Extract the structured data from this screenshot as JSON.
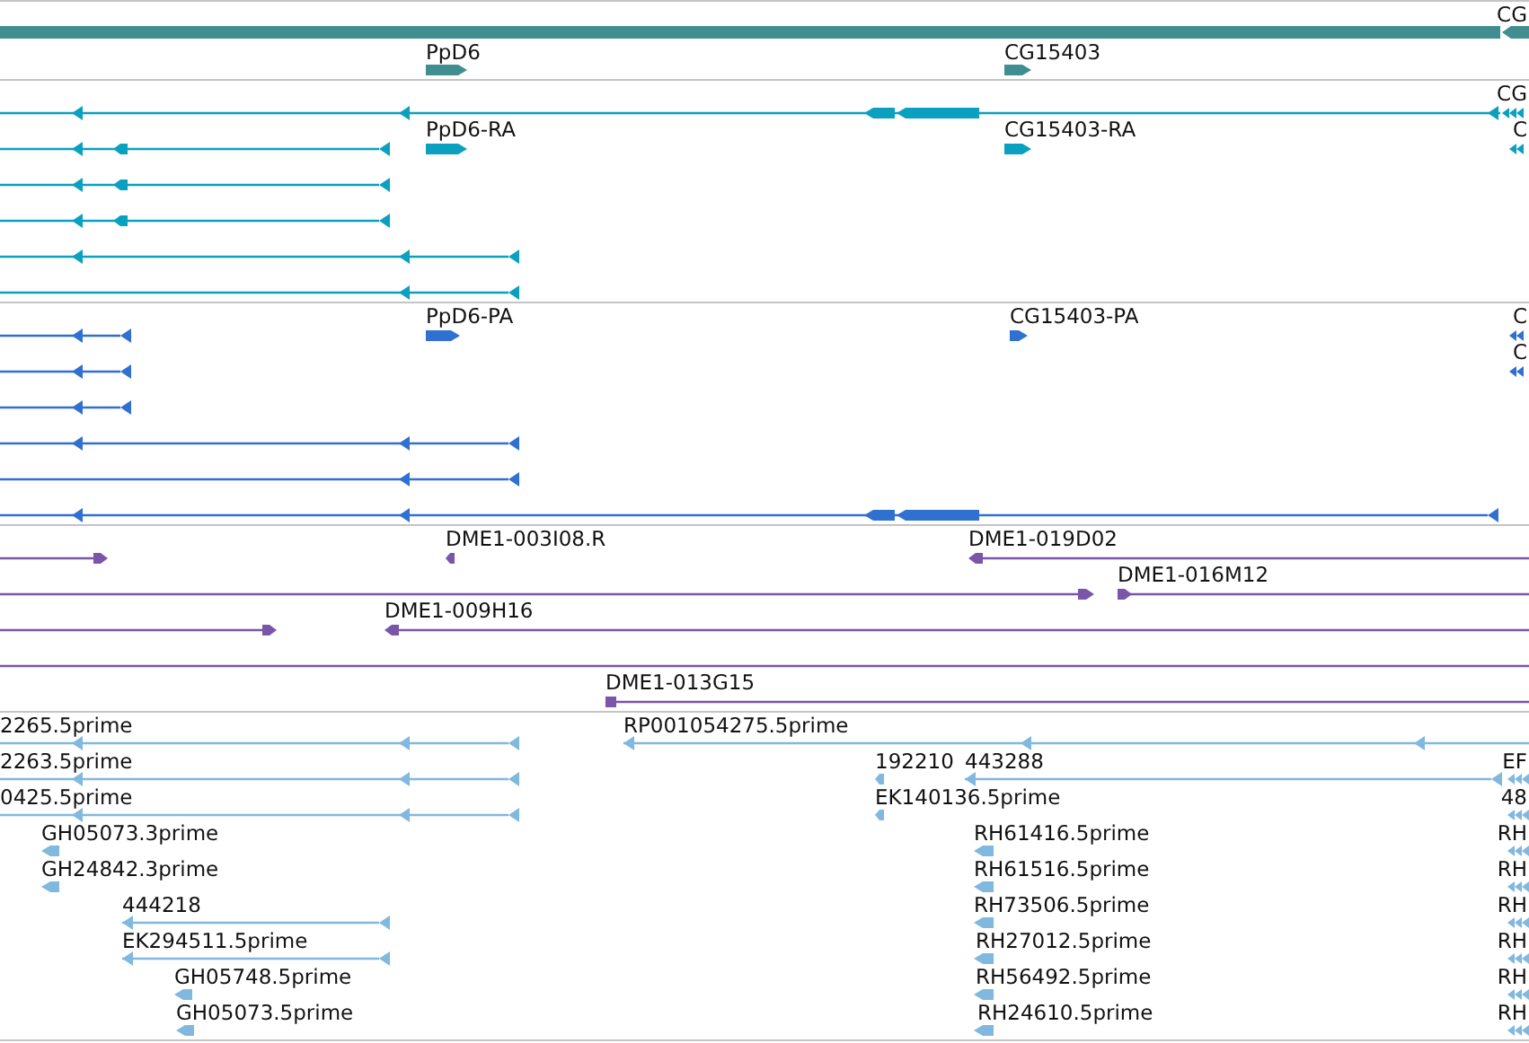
{
  "tracks": [
    {
      "kind": "gene",
      "labels": [
        "CG",
        "PpD6",
        "CG15403"
      ]
    },
    {
      "kind": "mrna",
      "labels": [
        "CG",
        "PpD6-RA",
        "CG15403-RA",
        "C"
      ]
    },
    {
      "kind": "cds",
      "labels": [
        "PpD6-PA",
        "CG15403-PA",
        "C",
        "C"
      ]
    },
    {
      "kind": "clone",
      "labels": [
        "DME1-003I08.R",
        "DME1-019D02",
        "DME1-016M12",
        "DME1-009H16",
        "DME1-013G15"
      ]
    },
    {
      "kind": "est",
      "labels": [
        "2265.5prime",
        "RP001054275.5prime",
        "2263.5prime",
        "192210",
        "443288",
        "EF",
        "0425.5prime",
        "EK140136.5prime",
        "48",
        "GH05073.3prime",
        "RH61416.5prime",
        "RH",
        "GH24842.3prime",
        "RH61516.5prime",
        "RH",
        "444218",
        "RH73506.5prime",
        "RH",
        "EK294511.5prime",
        "RH27012.5prime",
        "RH",
        "GH05748.5prime",
        "RH56492.5prime",
        "RH",
        "GH05073.5prime",
        "RH24610.5prime",
        "RH"
      ]
    }
  ]
}
